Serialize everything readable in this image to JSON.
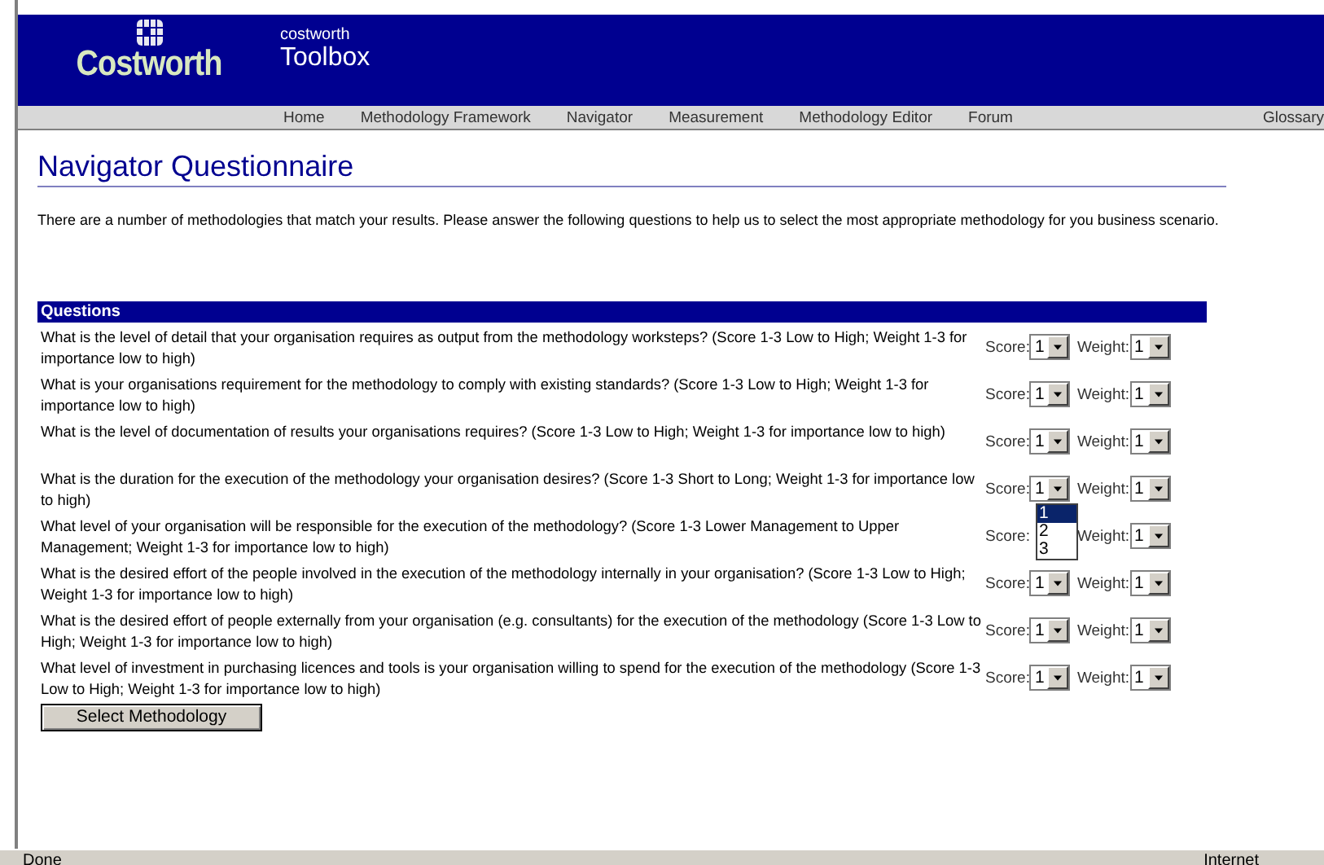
{
  "header": {
    "logo": "Costworth",
    "subtitle": "costworth",
    "title": "Toolbox"
  },
  "nav": [
    {
      "label": "Home"
    },
    {
      "label": "Methodology Framework"
    },
    {
      "label": "Navigator"
    },
    {
      "label": "Measurement"
    },
    {
      "label": "Methodology Editor"
    },
    {
      "label": "Forum"
    },
    {
      "label": "Glossary"
    }
  ],
  "page_title": "Navigator Questionnaire",
  "intro": "There are a number of methodologies that match your results. Please answer the following questions to help us to select the most appropriate methodology for you business scenario.",
  "table": {
    "heading": "Questions",
    "rows": [
      {
        "question": "What is the level of detail that your organisation requires as output from the methodology worksteps? (Score 1-3 Low to High; Weight 1-3 for importance low to high)",
        "score_label": "Score:",
        "score": "1",
        "weight_label": "Weight:",
        "weight": "1"
      },
      {
        "question": "What is your organisations requirement for the methodology to comply with existing standards? (Score 1-3 Low to High; Weight 1-3 for importance low to high)",
        "score_label": "Score:",
        "score": "1",
        "weight_label": "Weight:",
        "weight": "1"
      },
      {
        "question": "What is the level of documentation of results your organisations requires? (Score 1-3 Low to High; Weight 1-3 for importance low to high)",
        "score_label": "Score:",
        "score": "1",
        "weight_label": "Weight:",
        "weight": "1"
      },
      {
        "question": "What is the duration for the execution of the methodology your organisation desires? (Score 1-3 Short to Long; Weight 1-3 for importance low to high)",
        "score_label": "Score:",
        "score": "1",
        "weight_label": "Weight:",
        "weight": "1",
        "score_options": [
          {
            "label": "1",
            "selected": true
          },
          {
            "label": "2",
            "selected": false
          },
          {
            "label": "3",
            "selected": false
          }
        ]
      },
      {
        "question": "What level of your organisation will be responsible for the execution of the methodology? (Score 1-3 Lower Management to Upper Management; Weight 1-3 for importance low to high)",
        "score_label": "Score:",
        "weight_label": "Weight:",
        "weight": "1"
      },
      {
        "question": "What is the desired effort of the people involved in the execution of the methodology internally in your organisation? (Score 1-3 Low to High; Weight 1-3 for importance low to high)",
        "score_label": "Score:",
        "score": "1",
        "weight_label": "Weight:",
        "weight": "1"
      },
      {
        "question": "What is the desired effort of people externally from your organisation (e.g. consultants) for the execution of the methodology (Score 1-3 Low to High; Weight 1-3 for importance low to high)",
        "score_label": "Score:",
        "score": "1",
        "weight_label": "Weight:",
        "weight": "1"
      },
      {
        "question": "What level of investment in purchasing licences and tools is your organisation willing to spend for the execution of the methodology (Score 1-3 Low to High; Weight 1-3 for importance low to high)",
        "score_label": "Score:",
        "score": "1",
        "weight_label": "Weight:",
        "weight": "1"
      }
    ]
  },
  "button": "Select Methodology",
  "status_bar": {
    "text": "Done",
    "zone": "Internet"
  }
}
